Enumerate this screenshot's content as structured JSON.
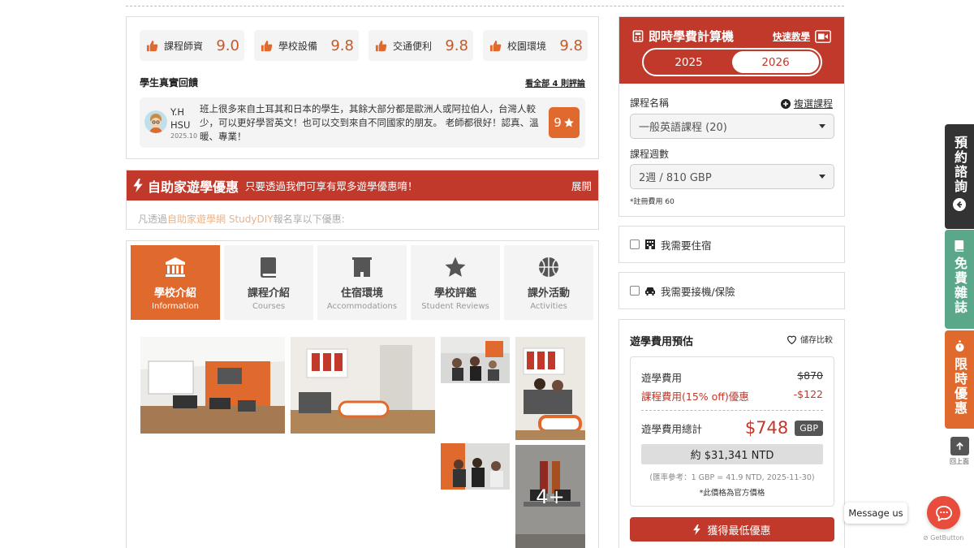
{
  "ratings": [
    {
      "label": "課程師資",
      "score": "9.0"
    },
    {
      "label": "學校設備",
      "score": "9.8"
    },
    {
      "label": "交通便利",
      "score": "9.8"
    },
    {
      "label": "校園環境",
      "score": "9.8"
    }
  ],
  "feedback": {
    "title": "學生真實回饋",
    "see_all": "看全部 4 則評論",
    "review": {
      "name": "Y.H HSU",
      "date": "2025.10",
      "text": "班上很多來自土耳其和日本的學生，其餘大部分都是歐洲人或阿拉伯人，台灣人較少，可以更好學習英文！也可以交到來自不同國家的朋友。 老師都很好！認真、溫暖、專業！",
      "score": "9"
    }
  },
  "promo": {
    "title": "自助家遊學優惠",
    "subtitle": "只要透過我們可享有眾多遊學優惠唷！",
    "expand": "展開",
    "text_prefix": "凡透過",
    "text_link": "自助家遊學網 StudyDIY",
    "text_suffix": "報名享以下優惠:"
  },
  "tabs": [
    {
      "label": "學校介紹",
      "sub": "Information",
      "icon": "school-building-icon",
      "active": true
    },
    {
      "label": "課程介紹",
      "sub": "Courses",
      "icon": "book-icon",
      "active": false
    },
    {
      "label": "住宿環境",
      "sub": "Accommodations",
      "icon": "building-icon",
      "active": false
    },
    {
      "label": "學校評鑑",
      "sub": "Student Reviews",
      "icon": "star-icon",
      "active": false
    },
    {
      "label": "課外活動",
      "sub": "Activities",
      "icon": "basketball-icon",
      "active": false
    }
  ],
  "gallery": {
    "more_label": "4+"
  },
  "calculator": {
    "title": "即時學費計算機",
    "quick_guide": "快速教學",
    "years": [
      "2025",
      "2026"
    ],
    "active_year": "2026",
    "course_label": "課程名稱",
    "add_course": "複選課程",
    "course_value": "一般英語課程 (20)",
    "weeks_label": "課程週數",
    "weeks_value": "2週 / 810 GBP",
    "reg_fee": "*註冊費用 60"
  },
  "options": {
    "housing": "我需要住宿",
    "pickup": "我需要接機/保險"
  },
  "estimate": {
    "title": "遊學費用預估",
    "save_compare": "儲存比較",
    "fee_label": "遊學費用",
    "fee_value": "$870",
    "discount_label": "課程費用(15% off)優惠",
    "discount_value": "-$122",
    "total_label": "遊學費用總計",
    "total_value": "$748",
    "currency": "GBP",
    "ntd": "約 $31,341 NTD",
    "rate_ref": "(匯率參考：1 GBP = 41.9 NTD, 2025-11-30)",
    "official_note": "*此價格為官方價格",
    "best_button": "獲得最低優惠"
  },
  "side_tabs": [
    {
      "label": "預約諮詢",
      "color": "#333333"
    },
    {
      "label": "免費雜誌",
      "color": "#5aa889"
    },
    {
      "label": "限時優惠",
      "color": "#e06a2e"
    }
  ],
  "back_to_top": "回上面",
  "messenger": {
    "bubble": "Message us",
    "brand": "GetButton"
  },
  "colors": {
    "brand_red": "#c0392b",
    "accent_orange": "#e06a2e"
  }
}
